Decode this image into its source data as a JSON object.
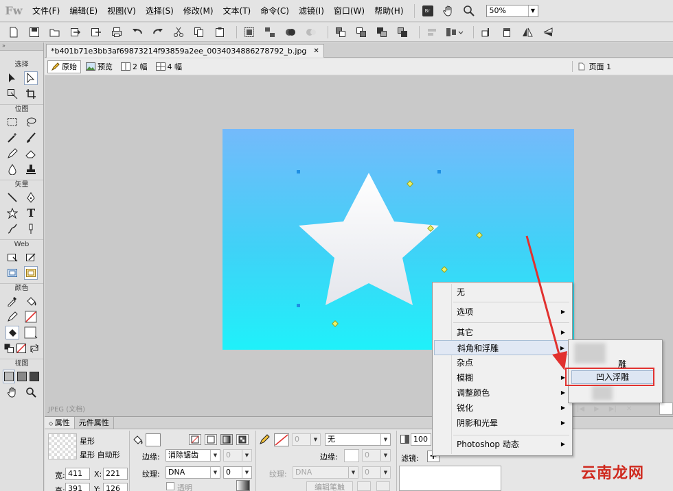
{
  "app": {
    "logo": "Fw",
    "menu": [
      "文件(F)",
      "编辑(E)",
      "视图(V)",
      "选择(S)",
      "修改(M)",
      "文本(T)",
      "命令(C)",
      "滤镜(I)",
      "窗口(W)",
      "帮助(H)"
    ],
    "bridge_badge": "Br",
    "zoom_value": "50%"
  },
  "toolbar": {
    "icons": [
      "new-icon",
      "save-icon",
      "open-icon",
      "import-icon",
      "export-icon",
      "print-icon",
      "undo-icon",
      "redo-icon",
      "cut-icon",
      "copy-icon",
      "paste-icon",
      "group-icon",
      "ungroup-icon",
      "join-icon",
      "split-icon",
      "bring-front-icon",
      "bring-forward-icon",
      "send-backward-icon",
      "send-back-icon",
      "align-icon",
      "distribute-icon",
      "rotate-icon",
      "flip-horizontal-icon",
      "flip-vertical-icon"
    ]
  },
  "tools": {
    "sections": {
      "select": "选择",
      "bitmap": "位图",
      "vector": "矢量",
      "web": "Web",
      "colors": "颜色",
      "view": "视图"
    }
  },
  "document": {
    "tab_title": "*b401b71e3bb3af69873214f93859a2ee_0034034886278792_b.jpg",
    "views": [
      "原始",
      "预览",
      "2 幅",
      "4 幅"
    ],
    "page": "页面 1",
    "status": "JPEG (文档)"
  },
  "properties": {
    "tabs": [
      "属性",
      "元件属性"
    ],
    "shape_name": "星形",
    "shape_type": "星形  自动形",
    "width_label": "宽:",
    "width": "411",
    "height_label": "高:",
    "height": "391",
    "x_label": "X:",
    "x": "221",
    "y_label": "Y:",
    "y": "126",
    "edge_label": "边缘:",
    "edge_value": "消除锯齿",
    "edge_num": "0",
    "texture_label": "纹理:",
    "texture_value": "DNA",
    "texture_num": "0",
    "transparent_label": "透明",
    "stroke_none": "无",
    "stroke_size": "0",
    "stroke_edge_label": "边缘:",
    "stroke_edge_num": "0",
    "stroke_texture_label": "纹理:",
    "stroke_texture_value": "DNA",
    "stroke_texture_num": "0",
    "edit_stroke": "编辑笔触",
    "opacity": "100",
    "filters_label": "滤镜:"
  },
  "context_menu": {
    "items": [
      "无",
      "选项",
      "其它",
      "斜角和浮雕",
      "杂点",
      "模糊",
      "调整颜色",
      "锐化",
      "阴影和光晕",
      "Photoshop 动态"
    ],
    "submenu_partial": "雕",
    "submenu_selected": "凹入浮雕"
  },
  "watermark": "云南龙网",
  "colors": {
    "canvas_top": "#74bafb",
    "canvas_bottom": "#1ff1fa",
    "highlight_border": "#e1312f",
    "arrow": "#e1312f"
  }
}
